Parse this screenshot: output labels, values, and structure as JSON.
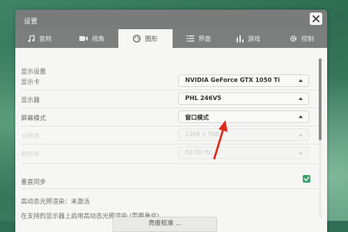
{
  "window": {
    "title": "设置"
  },
  "tabs": [
    {
      "label": "音频",
      "icon": "music-note-icon"
    },
    {
      "label": "视角",
      "icon": "camera-icon"
    },
    {
      "label": "图形",
      "icon": "palette-icon",
      "active": true
    },
    {
      "label": "界面",
      "icon": "list-icon"
    },
    {
      "label": "游戏",
      "icon": "bar-chart-icon"
    },
    {
      "label": "控制",
      "icon": "gear-icon"
    }
  ],
  "display": {
    "section_title": "显示设置",
    "gpu_label": "显示卡",
    "gpu_value": "NVIDIA GeForce GTX 1050 Ti",
    "monitor_label": "显示器",
    "monitor_value": "PHL 246V5",
    "screen_mode_label": "屏幕模式",
    "screen_mode_value": "窗口模式",
    "resolution_label": "分辨率",
    "resolution_value": "1366 x 768",
    "refresh_label": "刷新率",
    "refresh_value": "60.00 Hz",
    "vsync_label": "垂直同步",
    "vsync_checked": true
  },
  "hdr": {
    "status_text": "高动态光照渲染：未激活",
    "hint_text": "在支持的显示器上启用高动态光照渲染 (需要重启)",
    "calibrate_button": "亮度校准 ..."
  },
  "colors": {
    "accent_check": "#3aa56a",
    "annotation_arrow": "#e02a1f"
  }
}
